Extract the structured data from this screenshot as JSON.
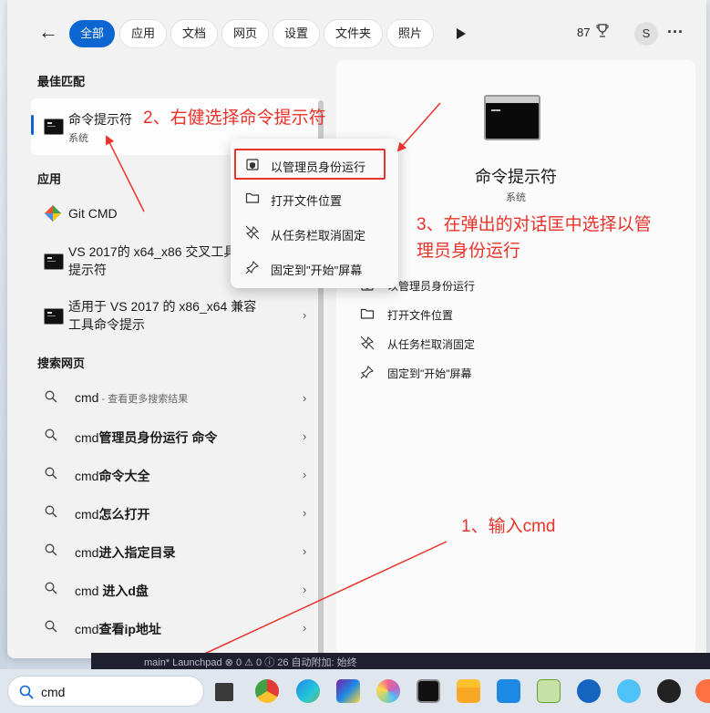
{
  "filters": {
    "back": "←",
    "tabs": [
      "全部",
      "应用",
      "文档",
      "网页",
      "设置",
      "文件夹",
      "照片"
    ],
    "points": "87",
    "avatar": "S",
    "more": "···"
  },
  "results": {
    "best_match_title": "最佳匹配",
    "best_match": {
      "title": "命令提示符",
      "subtitle": "系统"
    },
    "apps_title": "应用",
    "apps": [
      {
        "line1": "Git CMD",
        "line2": ""
      },
      {
        "line1": "VS 2017的 x64_x86 交叉工具",
        "line2": "提示符"
      },
      {
        "line1": "适用于 VS 2017 的 x86_x64 兼容",
        "line2": "工具命令提示"
      }
    ],
    "web_title": "搜索网页",
    "web": [
      {
        "prefix": "cmd",
        "bold": "",
        "hint": " - 查看更多搜索结果"
      },
      {
        "prefix": "cmd",
        "bold": "管理员身份运行 命令",
        "hint": ""
      },
      {
        "prefix": "cmd",
        "bold": "命令大全",
        "hint": ""
      },
      {
        "prefix": "cmd",
        "bold": "怎么打开",
        "hint": ""
      },
      {
        "prefix": "cmd",
        "bold": "进入指定目录",
        "hint": ""
      },
      {
        "prefix": "cmd ",
        "bold": "进入d盘",
        "hint": ""
      },
      {
        "prefix": "cmd",
        "bold": "查看ip地址",
        "hint": ""
      }
    ]
  },
  "preview": {
    "title": "命令提示符",
    "subtitle": "系统",
    "partial": "开",
    "actions": [
      "以管理员身份运行",
      "打开文件位置",
      "从任务栏取消固定",
      "固定到\"开始\"屏幕"
    ]
  },
  "context_menu": {
    "items": [
      "以管理员身份运行",
      "打开文件位置",
      "从任务栏取消固定",
      "固定到\"开始\"屏幕"
    ]
  },
  "annotations": {
    "step1": "1、输入cmd",
    "step2": "2、右健选择命令提示符",
    "step3_line1": "3、在弹出的对话匡中选择以管",
    "step3_line2": "理员身份运行"
  },
  "taskbar": {
    "search_value": "cmd",
    "strip_text": "main*   Launchpad   ⊗ 0 ⚠ 0 ⓘ 26   自动附加: 始终"
  },
  "colors": {
    "accent": "#0c66d2",
    "annotation": "#e8322a"
  }
}
